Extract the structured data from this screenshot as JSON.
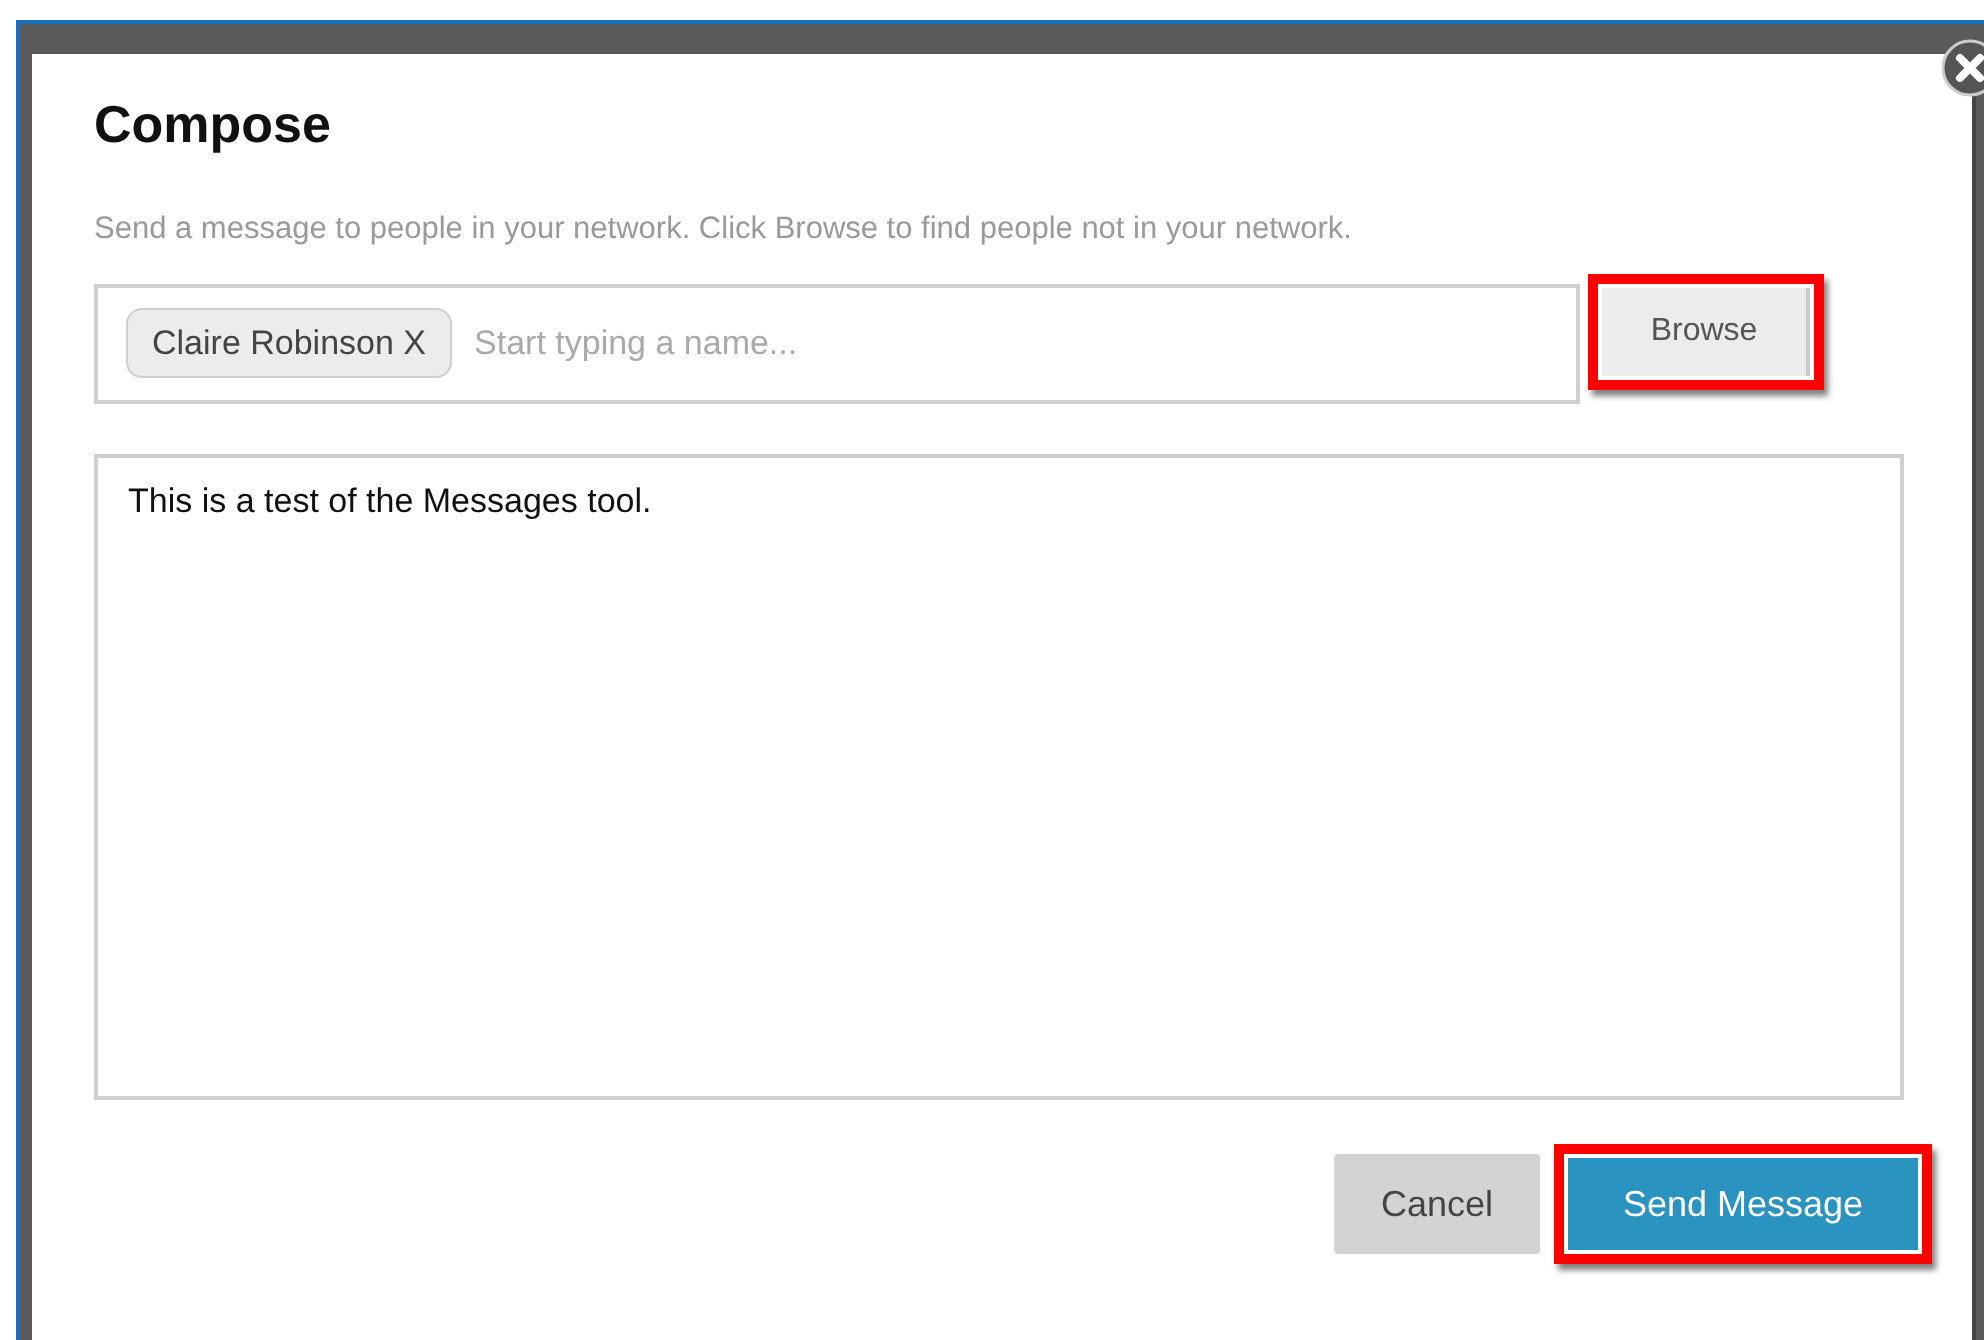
{
  "dialog": {
    "title": "Compose",
    "instructions": "Send a message to people in your network. Click Browse to find people not in your network.",
    "recipients": [
      {
        "name": "Claire Robinson X"
      }
    ],
    "recipient_field": {
      "placeholder": "Start typing a name..."
    },
    "browse_button": {
      "label": "Browse",
      "highlighted": true
    },
    "message": {
      "value": "This is a test of the Messages tool."
    },
    "buttons": [
      {
        "label": "Cancel",
        "kind": "secondary",
        "highlighted": false
      },
      {
        "label": "Send Message",
        "kind": "primary",
        "highlighted": true
      }
    ]
  }
}
